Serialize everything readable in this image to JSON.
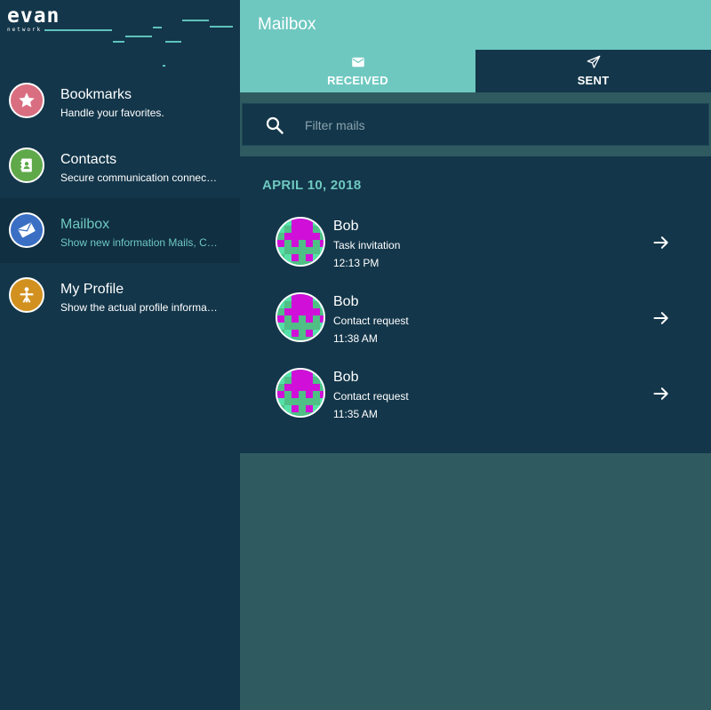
{
  "logo": {
    "word": "evan",
    "sub": "network"
  },
  "sidebar": {
    "items": [
      {
        "title": "Bookmarks",
        "subtitle": "Handle your favorites.",
        "color": "#d96e80",
        "icon": "star-icon"
      },
      {
        "title": "Contacts",
        "subtitle": "Secure communication connections",
        "color": "#5fa94a",
        "icon": "contact-book-icon"
      },
      {
        "title": "Mailbox",
        "subtitle": "Show new information Mails, Contact requests",
        "color": "#3a6fc4",
        "icon": "mail-icon",
        "active": true
      },
      {
        "title": "My Profile",
        "subtitle": "Show the actual profile information",
        "color": "#d2911f",
        "icon": "profile-icon"
      }
    ]
  },
  "header": {
    "title": "Mailbox"
  },
  "tabs": {
    "received": {
      "label": "RECEIVED",
      "icon": "envelope-icon",
      "active": true
    },
    "sent": {
      "label": "SENT",
      "icon": "paper-plane-icon"
    }
  },
  "filter": {
    "placeholder": "Filter mails",
    "icon": "search-icon"
  },
  "mails": {
    "date": "APRIL 10, 2018",
    "items": [
      {
        "sender": "Bob",
        "subject": "Task invitation",
        "time": "12:13 PM"
      },
      {
        "sender": "Bob",
        "subject": "Contact request",
        "time": "11:38 AM"
      },
      {
        "sender": "Bob",
        "subject": "Contact request",
        "time": "11:35 AM"
      }
    ]
  },
  "colors": {
    "accent": "#6ec8c0",
    "sidebar_bg": "#13364a",
    "page_bg": "#2f5a60",
    "avatar_magenta": "#d010d8",
    "avatar_green": "#55e0a8"
  }
}
